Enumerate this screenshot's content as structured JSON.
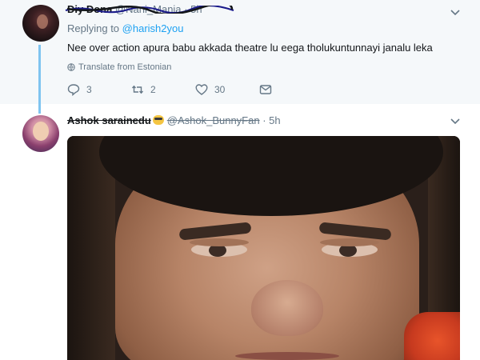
{
  "tweet1": {
    "name": "Diy Dona",
    "handle": "@Nani_Mania",
    "time": "· 5h",
    "replying_prefix": "Replying to ",
    "replying_to": "@harish2you",
    "text": "Nee  over action apura babu akkada theatre lu eega tholukuntunnayi janalu leka",
    "translate": "Translate from Estonian",
    "actions": {
      "replies": "3",
      "retweets": "2",
      "likes": "30"
    }
  },
  "tweet2": {
    "name": "Ashok sarainedu",
    "handle": "@Ashok_BunnyFan",
    "time": "· 5h"
  },
  "colors": {
    "accent": "#1da1f2",
    "thread_line": "#7fc4f0",
    "muted": "#657786"
  }
}
